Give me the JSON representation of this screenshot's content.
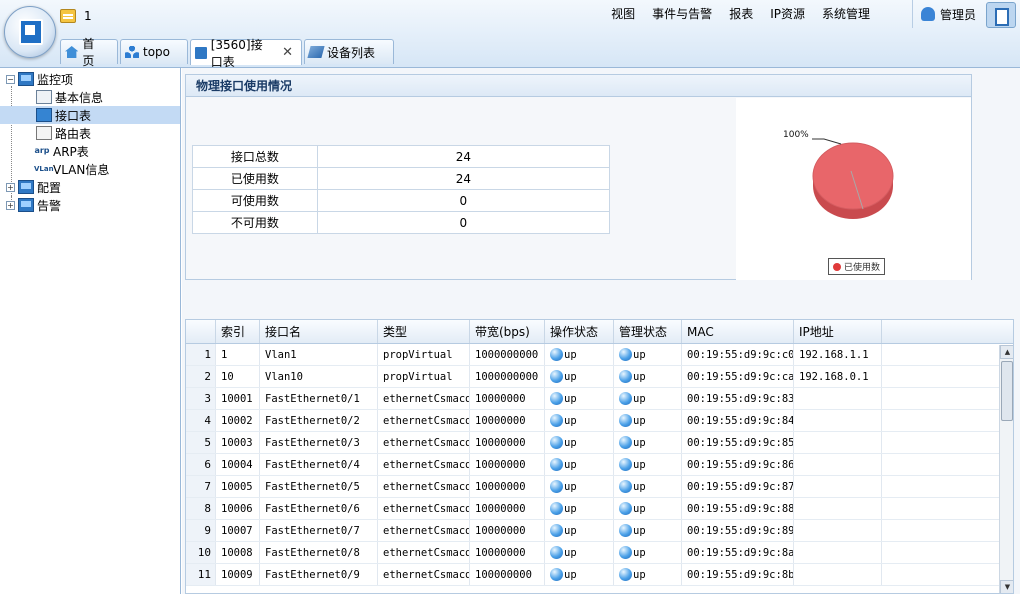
{
  "header": {
    "notification_count": "1",
    "menu": [
      "视图",
      "事件与告警",
      "报表",
      "IP资源",
      "系统管理"
    ],
    "user_label": "管理员"
  },
  "tabs": [
    {
      "label": "首 页",
      "icon": "home-icon"
    },
    {
      "label": "topo",
      "icon": "topology-icon"
    },
    {
      "label": "[3560]接口表",
      "icon": "port-icon",
      "active": true
    },
    {
      "label": "设备列表",
      "icon": "device-icon"
    }
  ],
  "sidebar": {
    "items": [
      {
        "label": "监控项",
        "level": 0,
        "expanded": true
      },
      {
        "label": "基本信息",
        "level": 1
      },
      {
        "label": "接口表",
        "level": 1,
        "selected": true
      },
      {
        "label": "路由表",
        "level": 1
      },
      {
        "label": "ARP表",
        "level": 1
      },
      {
        "label": "VLAN信息",
        "level": 1
      },
      {
        "label": "配置",
        "level": 0,
        "expanded": false
      },
      {
        "label": "告警",
        "level": 0,
        "expanded": false
      }
    ],
    "icon_text": {
      "arp": "arp",
      "vlan": "VLan"
    }
  },
  "panel": {
    "title": "物理接口使用情况",
    "stats": [
      {
        "label": "接口总数",
        "value": "24"
      },
      {
        "label": "已使用数",
        "value": "24"
      },
      {
        "label": "可使用数",
        "value": "0"
      },
      {
        "label": "不可用数",
        "value": "0"
      }
    ]
  },
  "chart_data": {
    "type": "pie",
    "labels": [
      "已使用数"
    ],
    "values": [
      100
    ],
    "slice_labels": [
      "100%"
    ],
    "colors": [
      "#e8666a"
    ],
    "legend": "bottom"
  },
  "grid": {
    "columns": [
      "",
      "索引",
      "接口名",
      "类型",
      "带宽(bps)",
      "操作状态",
      "管理状态",
      "MAC",
      "IP地址"
    ],
    "rows": [
      {
        "n": "1",
        "idx": "1",
        "name": "Vlan1",
        "type": "propVirtual",
        "bw": "1000000000",
        "op": "up",
        "admin": "up",
        "mac": "00:19:55:d9:9c:c0",
        "ip": "192.168.1.1"
      },
      {
        "n": "2",
        "idx": "10",
        "name": "Vlan10",
        "type": "propVirtual",
        "bw": "1000000000",
        "op": "up",
        "admin": "up",
        "mac": "00:19:55:d9:9c:ca",
        "ip": "192.168.0.1"
      },
      {
        "n": "3",
        "idx": "10001",
        "name": "FastEthernet0/1",
        "type": "ethernetCsmacd",
        "bw": "10000000",
        "op": "up",
        "admin": "up",
        "mac": "00:19:55:d9:9c:83",
        "ip": ""
      },
      {
        "n": "4",
        "idx": "10002",
        "name": "FastEthernet0/2",
        "type": "ethernetCsmacd",
        "bw": "10000000",
        "op": "up",
        "admin": "up",
        "mac": "00:19:55:d9:9c:84",
        "ip": ""
      },
      {
        "n": "5",
        "idx": "10003",
        "name": "FastEthernet0/3",
        "type": "ethernetCsmacd",
        "bw": "10000000",
        "op": "up",
        "admin": "up",
        "mac": "00:19:55:d9:9c:85",
        "ip": ""
      },
      {
        "n": "6",
        "idx": "10004",
        "name": "FastEthernet0/4",
        "type": "ethernetCsmacd",
        "bw": "10000000",
        "op": "up",
        "admin": "up",
        "mac": "00:19:55:d9:9c:86",
        "ip": ""
      },
      {
        "n": "7",
        "idx": "10005",
        "name": "FastEthernet0/5",
        "type": "ethernetCsmacd",
        "bw": "10000000",
        "op": "up",
        "admin": "up",
        "mac": "00:19:55:d9:9c:87",
        "ip": ""
      },
      {
        "n": "8",
        "idx": "10006",
        "name": "FastEthernet0/6",
        "type": "ethernetCsmacd",
        "bw": "10000000",
        "op": "up",
        "admin": "up",
        "mac": "00:19:55:d9:9c:88",
        "ip": ""
      },
      {
        "n": "9",
        "idx": "10007",
        "name": "FastEthernet0/7",
        "type": "ethernetCsmacd",
        "bw": "10000000",
        "op": "up",
        "admin": "up",
        "mac": "00:19:55:d9:9c:89",
        "ip": ""
      },
      {
        "n": "10",
        "idx": "10008",
        "name": "FastEthernet0/8",
        "type": "ethernetCsmacd",
        "bw": "10000000",
        "op": "up",
        "admin": "up",
        "mac": "00:19:55:d9:9c:8a",
        "ip": ""
      },
      {
        "n": "11",
        "idx": "10009",
        "name": "FastEthernet0/9",
        "type": "ethernetCsmacd",
        "bw": "100000000",
        "op": "up",
        "admin": "up",
        "mac": "00:19:55:d9:9c:8b",
        "ip": ""
      }
    ]
  }
}
